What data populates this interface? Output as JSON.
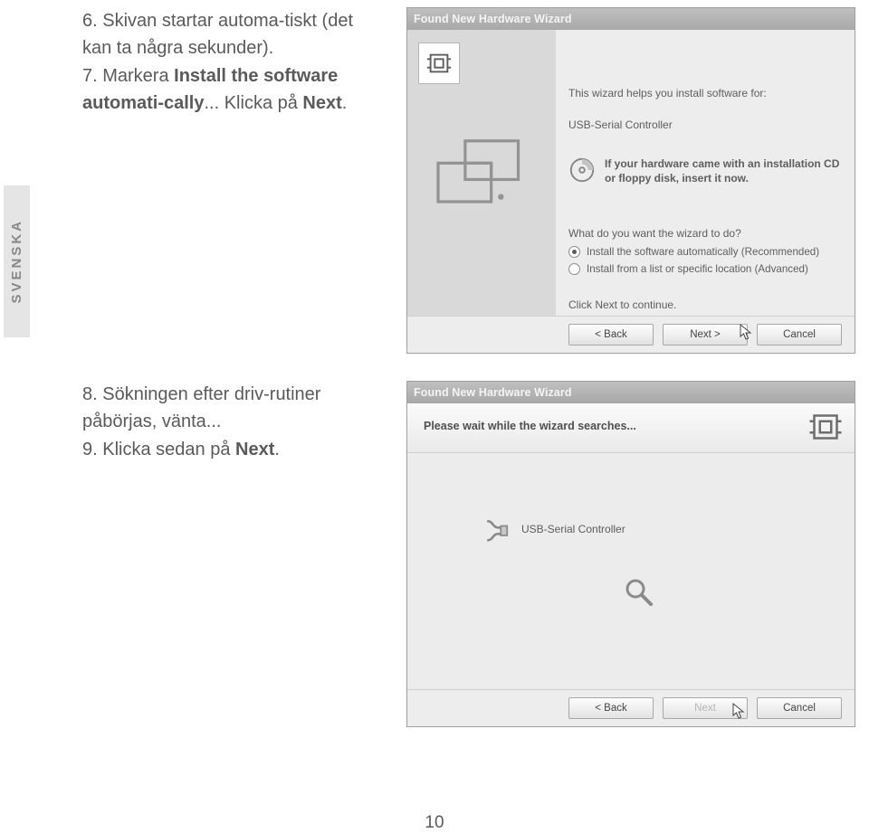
{
  "lang_tab": "SVENSKA",
  "page_number": "10",
  "instructions": {
    "block1": {
      "step6_pre": "6. Skivan startar automa-tiskt (det kan ta några sekunder).",
      "step7_pre": "7. Markera ",
      "step7_bold": "Install the software automati-cally",
      "step7_post": "... Klicka på ",
      "step7_next": "Next",
      "step7_end": "."
    },
    "block2": {
      "step8": "8. Sökningen efter driv-rutiner påbörjas, vänta...",
      "step9_pre": "9. Klicka sedan på ",
      "step9_bold": "Next",
      "step9_end": "."
    }
  },
  "dialog1": {
    "title": "Found New Hardware Wizard",
    "intro": "This wizard helps you install software for:",
    "device": "USB-Serial Controller",
    "cd_hint_l1": "If your hardware came with an installation CD",
    "cd_hint_l2": "or floppy disk, insert it now.",
    "question": "What do you want the wizard to do?",
    "opt_auto": "Install the software automatically (Recommended)",
    "opt_list": "Install from a list or specific location (Advanced)",
    "cont": "Click Next to continue.",
    "btn_back": "< Back",
    "btn_next": "Next >",
    "btn_cancel": "Cancel"
  },
  "dialog2": {
    "title": "Found New Hardware Wizard",
    "header": "Please wait while the wizard searches...",
    "device": "USB-Serial Controller",
    "btn_back": "< Back",
    "btn_next": "Next",
    "btn_cancel": "Cancel"
  }
}
